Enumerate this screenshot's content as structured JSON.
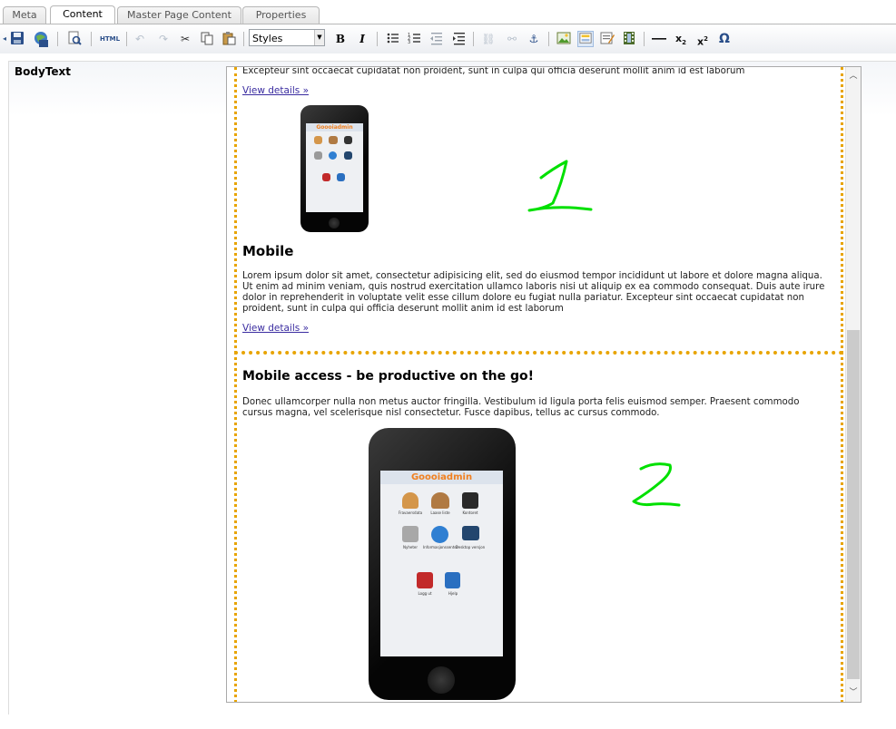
{
  "tabs": [
    {
      "label": "Meta",
      "active": false
    },
    {
      "label": "Content",
      "active": true
    },
    {
      "label": "Master Page Content",
      "active": false
    },
    {
      "label": "Properties",
      "active": false
    }
  ],
  "toolbar": {
    "html_label": "HTML",
    "styles_value": "Styles"
  },
  "field": {
    "label": "BodyText"
  },
  "content": {
    "block1": {
      "top_text": "Excepteur sint occaecat cupidatat non proident, sunt in culpa qui officia deserunt mollit anim id est laborum",
      "link1": "View details »",
      "heading": "Mobile",
      "paragraph": "Lorem ipsum dolor sit amet, consectetur adipisicing elit, sed do eiusmod tempor incididunt ut labore et dolore magna aliqua. Ut enim ad minim veniam, quis nostrud exercitation ullamco laboris nisi ut aliquip ex ea commodo consequat. Duis aute irure dolor in reprehenderit in voluptate velit esse cillum dolore eu fugiat nulla pariatur. Excepteur sint occaecat cupidatat non proident, sunt in culpa qui officia deserunt mollit anim id est laborum",
      "link2": "View details »"
    },
    "block2": {
      "heading": "Mobile access - be productive on the go!",
      "paragraph": "Donec ullamcorper nulla non metus auctor fringilla. Vestibulum id ligula porta felis euismod semper. Praesent commodo cursus magna, vel scelerisque nisl consectetur. Fusce dapibus, tellus ac cursus commodo."
    },
    "phone_app_name": "Goooiadmin",
    "phone_icons": [
      "Fravaersdata",
      "Laase liste",
      "Kontoret",
      "Nyheter",
      "Informasjonssenter",
      "Desktop versjon",
      "Logg ut",
      "Hjelp"
    ]
  },
  "annotations": [
    "1",
    "2"
  ],
  "colors": {
    "accent_border": "#e8a400",
    "annotation": "#00e000",
    "link": "#3a2ca0"
  }
}
